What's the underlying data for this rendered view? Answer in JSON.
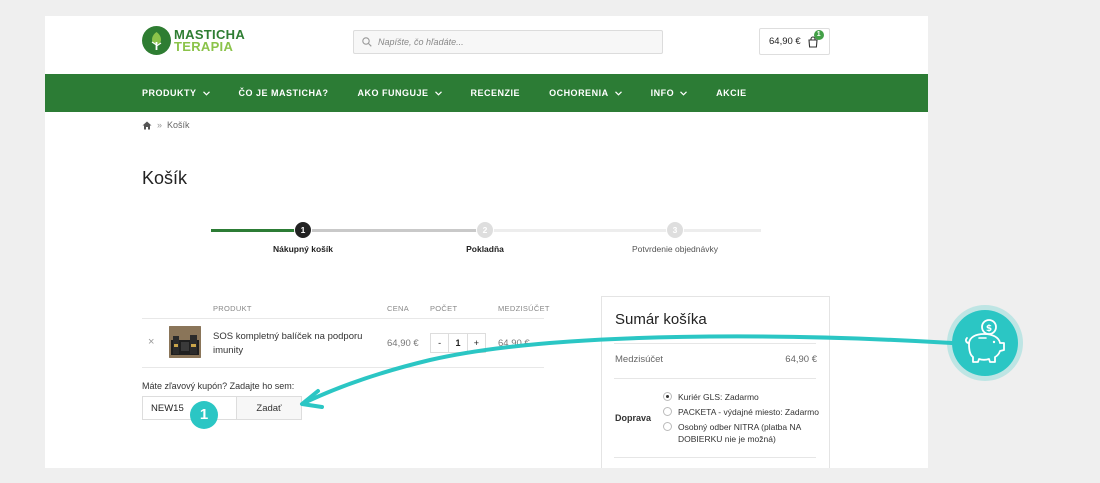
{
  "brand": {
    "line1": "MASTICHA",
    "line2": "TERAPIA",
    "green": "#2c7c35",
    "light_green": "#8bc34a",
    "accent_teal": "#2bc6c4"
  },
  "search": {
    "placeholder": "Napíšte, čo hľadáte...",
    "icon": "search-icon"
  },
  "cart": {
    "total": "64,90 €",
    "count": "1",
    "icon": "shopping-bag-icon"
  },
  "nav": {
    "items": [
      {
        "label": "PRODUKTY",
        "dropdown": true
      },
      {
        "label": "ČO JE MASTICHA?",
        "dropdown": false
      },
      {
        "label": "AKO FUNGUJE",
        "dropdown": true
      },
      {
        "label": "RECENZIE",
        "dropdown": false
      },
      {
        "label": "OCHORENIA",
        "dropdown": true
      },
      {
        "label": "INFO",
        "dropdown": true
      },
      {
        "label": "AKCIE",
        "dropdown": false
      }
    ]
  },
  "breadcrumb": {
    "home_icon": "home-icon",
    "separator": "»",
    "current": "Košík"
  },
  "page": {
    "title": "Košík"
  },
  "steps": {
    "active": 1,
    "items": [
      {
        "number": "1",
        "label": "Nákupný košík"
      },
      {
        "number": "2",
        "label": "Pokladňa"
      },
      {
        "number": "3",
        "label": "Potvrdenie objednávky"
      }
    ]
  },
  "cart_table": {
    "headers": {
      "product": "PRODUKT",
      "price": "CENA",
      "quantity": "POČET",
      "subtotal": "MEDZISÚČET"
    },
    "rows": [
      {
        "remove": "×",
        "name": "SOS kompletný balíček na podporu imunity",
        "price": "64,90 €",
        "qty_minus": "-",
        "qty": "1",
        "qty_plus": "+",
        "subtotal": "64,90 €"
      }
    ]
  },
  "coupon": {
    "label": "Máte zľavový kupón? Zadajte ho sem:",
    "value": "NEW15",
    "button": "Zadať"
  },
  "summary": {
    "title": "Sumár košíka",
    "subtotal_label": "Medzisúčet",
    "subtotal_value": "64,90 €",
    "shipping_label": "Doprava",
    "shipping_options": [
      {
        "label": "Kuriér GLS: Zadarmo",
        "selected": true
      },
      {
        "label": "PACKETA - výdajné miesto: Zadarmo",
        "selected": false
      },
      {
        "label": "Osobný odber NITRA (platba NA DOBIERKU nie je možná)",
        "selected": false
      }
    ]
  },
  "annotation": {
    "badge_number": "1",
    "icon": "piggy-bank-icon"
  }
}
